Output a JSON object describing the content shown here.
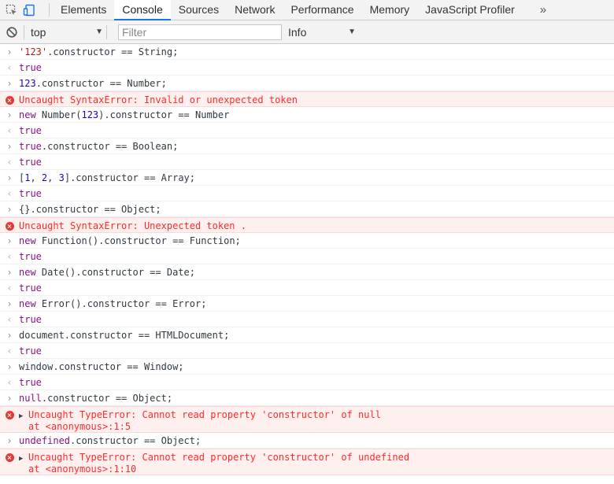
{
  "tabs": [
    "Elements",
    "Console",
    "Sources",
    "Network",
    "Performance",
    "Memory",
    "JavaScript Profiler"
  ],
  "active_tab": "Console",
  "more_tabs": "»",
  "toolbar": {
    "context": "top",
    "filter_placeholder": "Filter",
    "level": "Info"
  },
  "entries": [
    {
      "type": "input",
      "parts": [
        [
          "str",
          "'123'"
        ],
        [
          "",
          ".constructor == String;"
        ]
      ]
    },
    {
      "type": "result",
      "text": "true"
    },
    {
      "type": "input",
      "parts": [
        [
          "num",
          "123"
        ],
        [
          "",
          ".constructor == Number;"
        ]
      ]
    },
    {
      "type": "error",
      "text": "Uncaught SyntaxError: Invalid or unexpected token"
    },
    {
      "type": "input",
      "parts": [
        [
          "kw",
          "new"
        ],
        [
          "",
          " Number("
        ],
        [
          "num",
          "123"
        ],
        [
          "",
          ").constructor == Number"
        ]
      ]
    },
    {
      "type": "result",
      "text": "true"
    },
    {
      "type": "input",
      "parts": [
        [
          "kw",
          "true"
        ],
        [
          "",
          ".constructor == Boolean;"
        ]
      ]
    },
    {
      "type": "result",
      "text": "true"
    },
    {
      "type": "input",
      "parts": [
        [
          "",
          "["
        ],
        [
          "num",
          "1"
        ],
        [
          "",
          ", "
        ],
        [
          "num",
          "2"
        ],
        [
          "",
          ", "
        ],
        [
          "num",
          "3"
        ],
        [
          "",
          "].constructor == Array;"
        ]
      ]
    },
    {
      "type": "result",
      "text": "true"
    },
    {
      "type": "input",
      "parts": [
        [
          "",
          "{}.constructor == Object;"
        ]
      ]
    },
    {
      "type": "error",
      "text": "Uncaught SyntaxError: Unexpected token ."
    },
    {
      "type": "input",
      "parts": [
        [
          "kw",
          "new"
        ],
        [
          "",
          " Function().constructor == Function;"
        ]
      ]
    },
    {
      "type": "result",
      "text": "true"
    },
    {
      "type": "input",
      "parts": [
        [
          "kw",
          "new"
        ],
        [
          "",
          " Date().constructor == Date;"
        ]
      ]
    },
    {
      "type": "result",
      "text": "true"
    },
    {
      "type": "input",
      "parts": [
        [
          "kw",
          "new"
        ],
        [
          "",
          " Error().constructor == Error;"
        ]
      ]
    },
    {
      "type": "result",
      "text": "true"
    },
    {
      "type": "input",
      "parts": [
        [
          "",
          "document.constructor == HTMLDocument;"
        ]
      ]
    },
    {
      "type": "result",
      "text": "true"
    },
    {
      "type": "input",
      "parts": [
        [
          "",
          "window.constructor == Window;"
        ]
      ]
    },
    {
      "type": "result",
      "text": "true"
    },
    {
      "type": "input",
      "parts": [
        [
          "kw",
          "null"
        ],
        [
          "",
          ".constructor == Object;"
        ]
      ]
    },
    {
      "type": "error_stack",
      "text": "Uncaught TypeError: Cannot read property 'constructor' of null",
      "stack": "at <anonymous>:1:5"
    },
    {
      "type": "input",
      "parts": [
        [
          "kw",
          "undefined"
        ],
        [
          "",
          ".constructor == Object;"
        ]
      ]
    },
    {
      "type": "error_stack",
      "text": "Uncaught TypeError: Cannot read property 'constructor' of undefined",
      "stack": "at <anonymous>:1:10"
    }
  ]
}
